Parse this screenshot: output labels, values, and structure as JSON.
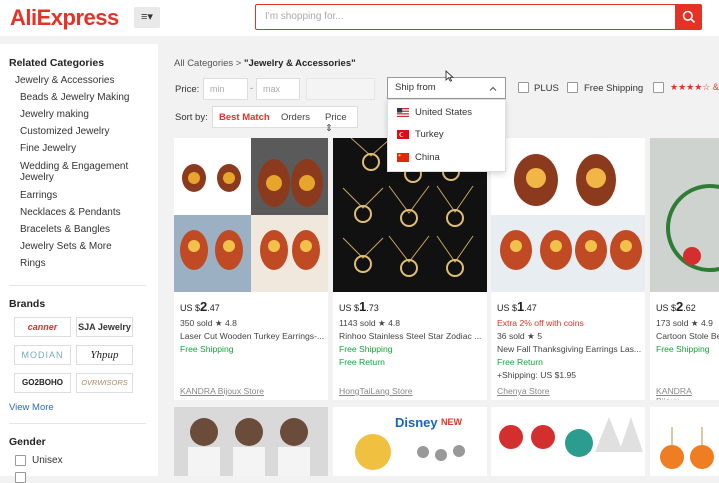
{
  "header": {
    "logo": "AliExpress",
    "menu_label": "≡▾",
    "search_placeholder": "I'm shopping for..."
  },
  "sidebar": {
    "related_title": "Related Categories",
    "categories": [
      "Jewelry & Accessories",
      "Beads & Jewelry Making",
      "Jewelry making",
      "Customized Jewelry",
      "Fine Jewelry",
      "Wedding & Engagement",
      "Jewelry",
      "Earrings",
      "Necklaces & Pendants",
      "Bracelets & Bangles",
      "Jewelry Sets & More",
      "Rings"
    ],
    "brands_title": "Brands",
    "brands": [
      "canner",
      "SJA Jewelry",
      "MODIAN",
      "Yhpup",
      "GO2BOHO",
      "OVRWISORS"
    ],
    "view_more": "View More",
    "gender_title": "Gender",
    "gender_options": [
      "Unisex"
    ]
  },
  "breadcrumb": {
    "root": "All Categories",
    "sep": ">",
    "current": "\"Jewelry & Accessories\""
  },
  "filters": {
    "price_label": "Price:",
    "min": "min",
    "dash": "-",
    "max": "max",
    "ship_from": "Ship from",
    "plus": "PLUS",
    "free_shipping": "Free Shipping",
    "stars": "★★★★☆ &"
  },
  "sort": {
    "label": "Sort by:",
    "best_match": "Best Match",
    "orders": "Orders",
    "price": "Price ⇕"
  },
  "ship_options": [
    {
      "label": "United States"
    },
    {
      "label": "Turkey"
    },
    {
      "label": "China"
    }
  ],
  "products": [
    {
      "currency": "US $",
      "price_int": "2",
      "price_dec": ".47",
      "sold_rating": "350 sold  ★ 4.8",
      "title": "Laser Cut Wooden Turkey Earrings-...",
      "line3": "Free Shipping",
      "line4": "",
      "store": "KANDRA Bijoux Store"
    },
    {
      "currency": "US $",
      "price_int": "1",
      "price_dec": ".73",
      "sold_rating": "1143 sold  ★ 4.8",
      "title": "Rinhoo Stainless Steel Star Zodiac ...",
      "line3": "Free Shipping",
      "line4": "Free Return",
      "store": "HongTaiLang Store"
    },
    {
      "currency": "US $",
      "price_int": "1",
      "price_dec": ".47",
      "promo": "Extra 2% off with coins",
      "sold_rating": "36 sold  ★ 5",
      "title": "New Fall Thanksgiving Earrings Las...",
      "line3": "Free Return",
      "line4": "+Shipping: US $1.95",
      "store": "Chenya Store"
    },
    {
      "currency": "US $",
      "price_int": "2",
      "price_dec": ".62",
      "sold_rating": "173 sold  ★ 4.9",
      "title": "Cartoon Stole Be...",
      "line3": "Free Shipping",
      "line4": "",
      "store": "KANDRA Bijoux..."
    }
  ],
  "colors": {
    "brand_red": "#e43225",
    "green": "#12a33a",
    "link": "#2b6cb8"
  }
}
